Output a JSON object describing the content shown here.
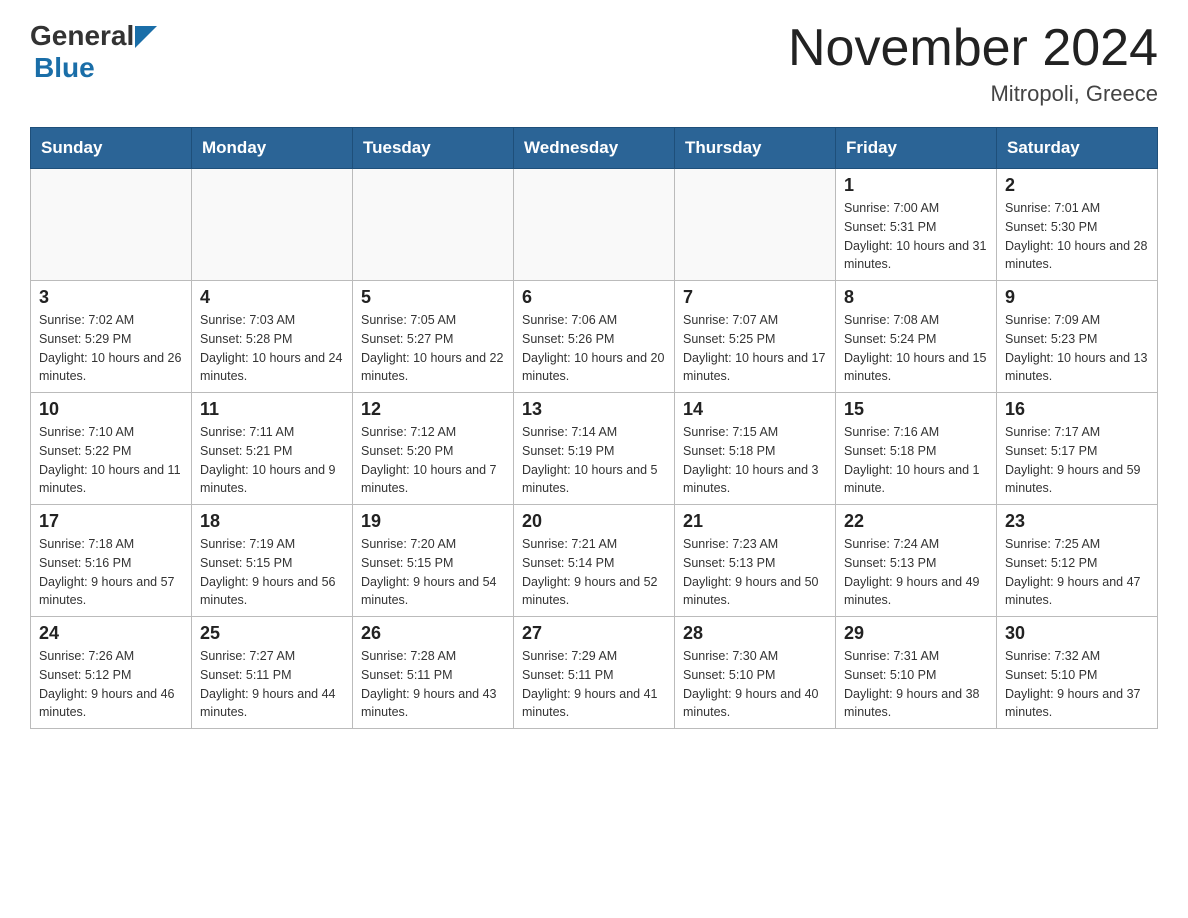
{
  "header": {
    "logo_general": "General",
    "logo_blue": "Blue",
    "title": "November 2024",
    "subtitle": "Mitropoli, Greece"
  },
  "calendar": {
    "days_of_week": [
      "Sunday",
      "Monday",
      "Tuesday",
      "Wednesday",
      "Thursday",
      "Friday",
      "Saturday"
    ],
    "weeks": [
      [
        {
          "day": "",
          "info": ""
        },
        {
          "day": "",
          "info": ""
        },
        {
          "day": "",
          "info": ""
        },
        {
          "day": "",
          "info": ""
        },
        {
          "day": "",
          "info": ""
        },
        {
          "day": "1",
          "info": "Sunrise: 7:00 AM\nSunset: 5:31 PM\nDaylight: 10 hours and 31 minutes."
        },
        {
          "day": "2",
          "info": "Sunrise: 7:01 AM\nSunset: 5:30 PM\nDaylight: 10 hours and 28 minutes."
        }
      ],
      [
        {
          "day": "3",
          "info": "Sunrise: 7:02 AM\nSunset: 5:29 PM\nDaylight: 10 hours and 26 minutes."
        },
        {
          "day": "4",
          "info": "Sunrise: 7:03 AM\nSunset: 5:28 PM\nDaylight: 10 hours and 24 minutes."
        },
        {
          "day": "5",
          "info": "Sunrise: 7:05 AM\nSunset: 5:27 PM\nDaylight: 10 hours and 22 minutes."
        },
        {
          "day": "6",
          "info": "Sunrise: 7:06 AM\nSunset: 5:26 PM\nDaylight: 10 hours and 20 minutes."
        },
        {
          "day": "7",
          "info": "Sunrise: 7:07 AM\nSunset: 5:25 PM\nDaylight: 10 hours and 17 minutes."
        },
        {
          "day": "8",
          "info": "Sunrise: 7:08 AM\nSunset: 5:24 PM\nDaylight: 10 hours and 15 minutes."
        },
        {
          "day": "9",
          "info": "Sunrise: 7:09 AM\nSunset: 5:23 PM\nDaylight: 10 hours and 13 minutes."
        }
      ],
      [
        {
          "day": "10",
          "info": "Sunrise: 7:10 AM\nSunset: 5:22 PM\nDaylight: 10 hours and 11 minutes."
        },
        {
          "day": "11",
          "info": "Sunrise: 7:11 AM\nSunset: 5:21 PM\nDaylight: 10 hours and 9 minutes."
        },
        {
          "day": "12",
          "info": "Sunrise: 7:12 AM\nSunset: 5:20 PM\nDaylight: 10 hours and 7 minutes."
        },
        {
          "day": "13",
          "info": "Sunrise: 7:14 AM\nSunset: 5:19 PM\nDaylight: 10 hours and 5 minutes."
        },
        {
          "day": "14",
          "info": "Sunrise: 7:15 AM\nSunset: 5:18 PM\nDaylight: 10 hours and 3 minutes."
        },
        {
          "day": "15",
          "info": "Sunrise: 7:16 AM\nSunset: 5:18 PM\nDaylight: 10 hours and 1 minute."
        },
        {
          "day": "16",
          "info": "Sunrise: 7:17 AM\nSunset: 5:17 PM\nDaylight: 9 hours and 59 minutes."
        }
      ],
      [
        {
          "day": "17",
          "info": "Sunrise: 7:18 AM\nSunset: 5:16 PM\nDaylight: 9 hours and 57 minutes."
        },
        {
          "day": "18",
          "info": "Sunrise: 7:19 AM\nSunset: 5:15 PM\nDaylight: 9 hours and 56 minutes."
        },
        {
          "day": "19",
          "info": "Sunrise: 7:20 AM\nSunset: 5:15 PM\nDaylight: 9 hours and 54 minutes."
        },
        {
          "day": "20",
          "info": "Sunrise: 7:21 AM\nSunset: 5:14 PM\nDaylight: 9 hours and 52 minutes."
        },
        {
          "day": "21",
          "info": "Sunrise: 7:23 AM\nSunset: 5:13 PM\nDaylight: 9 hours and 50 minutes."
        },
        {
          "day": "22",
          "info": "Sunrise: 7:24 AM\nSunset: 5:13 PM\nDaylight: 9 hours and 49 minutes."
        },
        {
          "day": "23",
          "info": "Sunrise: 7:25 AM\nSunset: 5:12 PM\nDaylight: 9 hours and 47 minutes."
        }
      ],
      [
        {
          "day": "24",
          "info": "Sunrise: 7:26 AM\nSunset: 5:12 PM\nDaylight: 9 hours and 46 minutes."
        },
        {
          "day": "25",
          "info": "Sunrise: 7:27 AM\nSunset: 5:11 PM\nDaylight: 9 hours and 44 minutes."
        },
        {
          "day": "26",
          "info": "Sunrise: 7:28 AM\nSunset: 5:11 PM\nDaylight: 9 hours and 43 minutes."
        },
        {
          "day": "27",
          "info": "Sunrise: 7:29 AM\nSunset: 5:11 PM\nDaylight: 9 hours and 41 minutes."
        },
        {
          "day": "28",
          "info": "Sunrise: 7:30 AM\nSunset: 5:10 PM\nDaylight: 9 hours and 40 minutes."
        },
        {
          "day": "29",
          "info": "Sunrise: 7:31 AM\nSunset: 5:10 PM\nDaylight: 9 hours and 38 minutes."
        },
        {
          "day": "30",
          "info": "Sunrise: 7:32 AM\nSunset: 5:10 PM\nDaylight: 9 hours and 37 minutes."
        }
      ]
    ]
  }
}
